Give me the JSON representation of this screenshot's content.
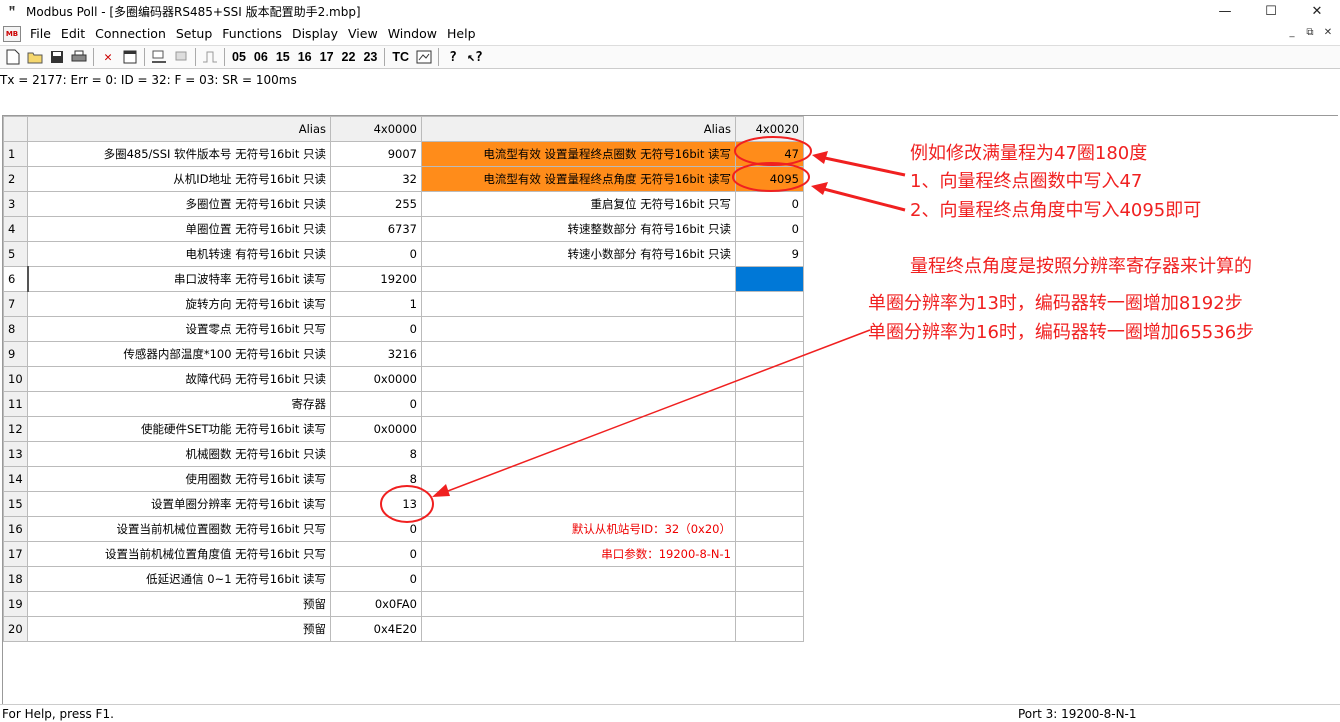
{
  "window": {
    "title": "Modbus Poll - [多圈编码器RS485+SSI 版本配置助手2.mbp]",
    "controls": [
      "—",
      "☐",
      "✕"
    ]
  },
  "menu": {
    "items": [
      {
        "label": "File"
      },
      {
        "label": "Edit"
      },
      {
        "label": "Connection"
      },
      {
        "label": "Setup"
      },
      {
        "label": "Functions"
      },
      {
        "label": "Display"
      },
      {
        "label": "View"
      },
      {
        "label": "Window"
      },
      {
        "label": "Help"
      }
    ],
    "mdi_controls": [
      "_",
      "⧉",
      "✕"
    ]
  },
  "toolbar": {
    "function_codes": [
      "05",
      "06",
      "15",
      "16",
      "17",
      "22",
      "23"
    ],
    "tc_label": "TC"
  },
  "status_line": "Tx = 2177: Err = 0: ID = 32: F = 03: SR = 100ms",
  "grid": {
    "headers": {
      "alias1": "Alias",
      "addr1": "4x0000",
      "alias2": "Alias",
      "addr2": "4x0020"
    },
    "rows": [
      {
        "n": "1",
        "a1": "多圈485/SSI  软件版本号 无符号16bit 只读",
        "v1": "9007",
        "a2": "电流型有效 设置量程终点圈数 无符号16bit 读写",
        "v2": "47"
      },
      {
        "n": "2",
        "a1": "从机ID地址 无符号16bit 只读",
        "v1": "32",
        "a2": "电流型有效 设置量程终点角度 无符号16bit 读写",
        "v2": "4095"
      },
      {
        "n": "3",
        "a1": "多圈位置 无符号16bit 只读",
        "v1": "255",
        "a2": "重启复位 无符号16bit 只写",
        "v2": "0"
      },
      {
        "n": "4",
        "a1": "单圈位置 无符号16bit 只读",
        "v1": "6737",
        "a2": "转速整数部分 有符号16bit 只读",
        "v2": "0"
      },
      {
        "n": "5",
        "a1": "电机转速 有符号16bit 只读",
        "v1": "0",
        "a2": "转速小数部分 有符号16bit 只读",
        "v2": "9"
      },
      {
        "n": "6",
        "a1": "串口波特率 无符号16bit 读写",
        "v1": "19200",
        "a2": "",
        "v2": ""
      },
      {
        "n": "7",
        "a1": "旋转方向 无符号16bit 读写",
        "v1": "1",
        "a2": "",
        "v2": ""
      },
      {
        "n": "8",
        "a1": "设置零点 无符号16bit 只写",
        "v1": "0",
        "a2": "",
        "v2": ""
      },
      {
        "n": "9",
        "a1": "传感器内部温度*100 无符号16bit 只读",
        "v1": "3216",
        "a2": "",
        "v2": ""
      },
      {
        "n": "10",
        "a1": "故障代码 无符号16bit 只读",
        "v1": "0x0000",
        "a2": "",
        "v2": ""
      },
      {
        "n": "11",
        "a1": "寄存器",
        "v1": "0",
        "a2": "",
        "v2": ""
      },
      {
        "n": "12",
        "a1": "使能硬件SET功能 无符号16bit 读写",
        "v1": "0x0000",
        "a2": "",
        "v2": ""
      },
      {
        "n": "13",
        "a1": "机械圈数 无符号16bit 只读",
        "v1": "8",
        "a2": "",
        "v2": ""
      },
      {
        "n": "14",
        "a1": "使用圈数 无符号16bit 读写",
        "v1": "8",
        "a2": "",
        "v2": ""
      },
      {
        "n": "15",
        "a1": "设置单圈分辨率 无符号16bit 读写",
        "v1": "13",
        "a2": "",
        "v2": ""
      },
      {
        "n": "16",
        "a1": "设置当前机械位置圈数 无符号16bit 只写",
        "v1": "0",
        "a2": "默认从机站号ID：32（0x20）",
        "v2": ""
      },
      {
        "n": "17",
        "a1": "设置当前机械位置角度值 无符号16bit 只写",
        "v1": "0",
        "a2": "串口参数：19200-8-N-1",
        "v2": ""
      },
      {
        "n": "18",
        "a1": "低延迟通信 0~1 无符号16bit 读写",
        "v1": "0",
        "a2": "",
        "v2": ""
      },
      {
        "n": "19",
        "a1": "预留",
        "v1": "0x0FA0",
        "a2": "",
        "v2": ""
      },
      {
        "n": "20",
        "a1": "预留",
        "v1": "0x4E20",
        "a2": "",
        "v2": ""
      }
    ]
  },
  "annotations": {
    "line1": "例如修改满量程为47圈180度",
    "line2": "1、向量程终点圈数中写入47",
    "line3": "2、向量程终点角度中写入4095即可",
    "line4": "量程终点角度是按照分辨率寄存器来计算的",
    "line5": "单圈分辨率为13时，编码器转一圈增加8192步",
    "line6": "单圈分辨率为16时，编码器转一圈增加65536步",
    "color": "#f02020"
  },
  "statusbar": {
    "left": "For Help, press F1.",
    "right": "Port 3: 19200-8-N-1"
  },
  "colors": {
    "orange_highlight": "#ff8c1a",
    "selection_blue": "#0078d7"
  }
}
